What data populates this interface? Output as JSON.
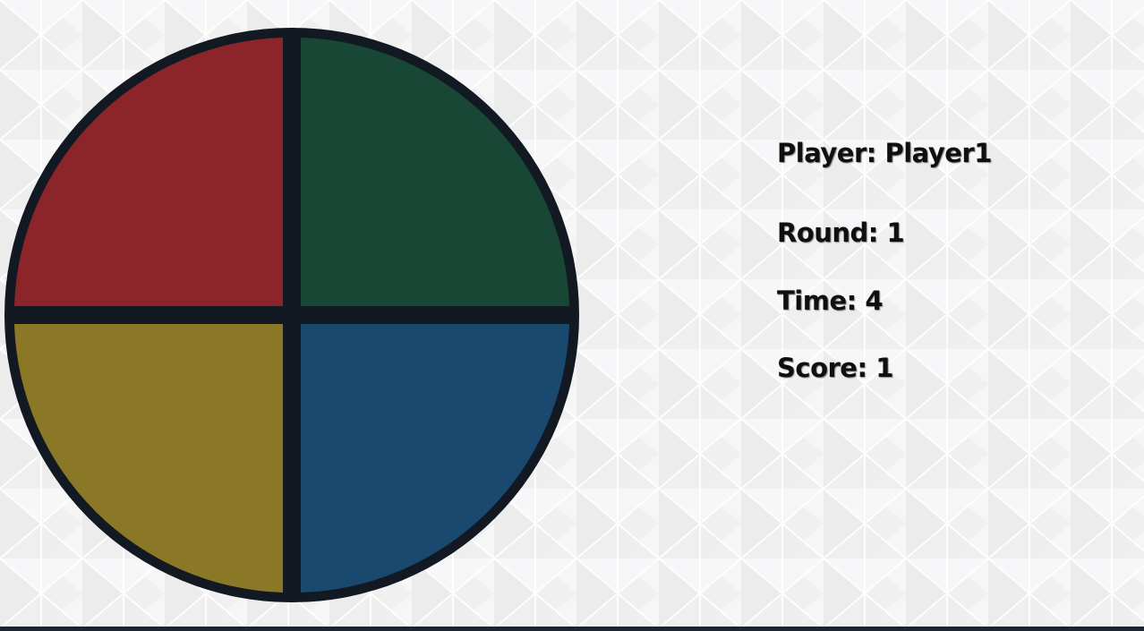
{
  "board": {
    "pads": [
      {
        "id": "red",
        "color": "#8c252a"
      },
      {
        "id": "green",
        "color": "#184835"
      },
      {
        "id": "yellow",
        "color": "#8a7827"
      },
      {
        "id": "blue",
        "color": "#1a4970"
      }
    ],
    "frame_color": "#131922"
  },
  "status": {
    "player_label": "Player:",
    "player_name": "Player1",
    "round_label": "Round:",
    "round_value": "1",
    "time_label": "Time:",
    "time_value": "4",
    "score_label": "Score:",
    "score_value": "1"
  },
  "colors": {
    "background": "#f5f5f6",
    "text": "#0f0f0f"
  }
}
